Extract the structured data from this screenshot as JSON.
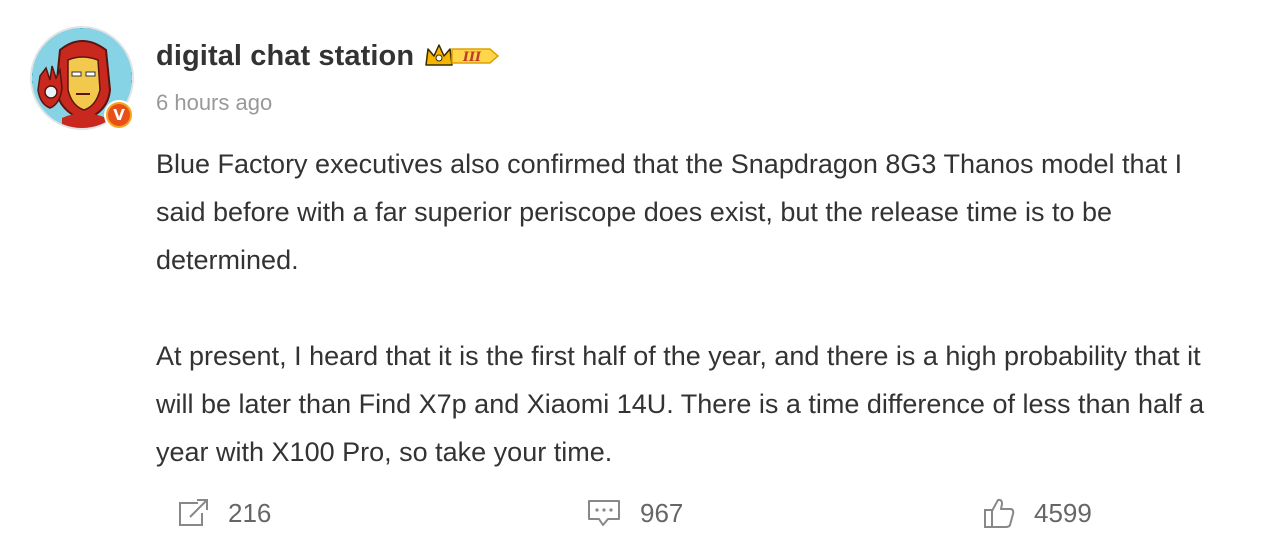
{
  "post": {
    "author": {
      "name": "digital chat station",
      "level_badge": "III",
      "verified_mark": "V"
    },
    "timestamp": "6 hours ago",
    "content": {
      "paragraph_1": "Blue Factory executives also confirmed that the Snapdragon 8G3 Thanos model that I said before with a far superior periscope does exist, but the release time is to be determined.",
      "paragraph_2": "At present, I heard that it is the first half of the year, and there is a high probability that it will be later than Find X7p and Xiaomi 14U. There is a time difference of less than half a year with X100 Pro, so take your time."
    },
    "actions": {
      "repost": {
        "icon": "repost-icon",
        "count": "216"
      },
      "comment": {
        "icon": "comment-icon",
        "count": "967"
      },
      "like": {
        "icon": "thumbs-up-icon",
        "count": "4599"
      }
    }
  },
  "colors": {
    "username": "#333333",
    "timestamp": "#999999",
    "body_text": "#333333",
    "action_text": "#666666",
    "verified_badge": "#e8501a",
    "level_badge": "#f5b400"
  }
}
